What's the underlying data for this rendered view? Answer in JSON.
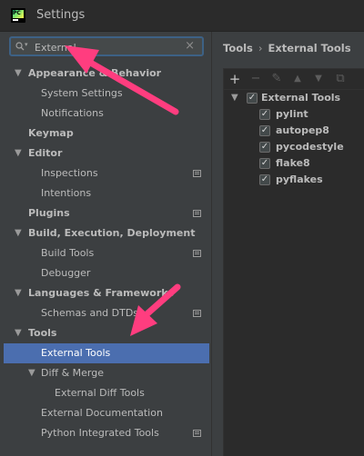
{
  "window": {
    "title": "Settings",
    "app_icon": "pycharm-icon"
  },
  "search": {
    "value": "External",
    "placeholder": ""
  },
  "tree": [
    {
      "label": "Appearance & Behavior",
      "bold": true,
      "expanded": true
    },
    {
      "label": "System Settings"
    },
    {
      "label": "Notifications"
    },
    {
      "label": "Keymap",
      "bold": true
    },
    {
      "label": "Editor",
      "bold": true,
      "expanded": true
    },
    {
      "label": "Inspections",
      "project_icon": true
    },
    {
      "label": "Intentions"
    },
    {
      "label": "Plugins",
      "bold": true,
      "project_icon": true
    },
    {
      "label": "Build, Execution, Deployment",
      "bold": true,
      "expanded": true
    },
    {
      "label": "Build Tools",
      "project_icon": true
    },
    {
      "label": "Debugger"
    },
    {
      "label": "Languages & Frameworks",
      "bold": true,
      "expanded": true
    },
    {
      "label": "Schemas and DTDs",
      "project_icon": true
    },
    {
      "label": "Tools",
      "bold": true,
      "expanded": true
    },
    {
      "label": "External Tools",
      "selected": true
    },
    {
      "label": "Diff & Merge",
      "expanded": true
    },
    {
      "label": "External Diff Tools"
    },
    {
      "label": "External Documentation"
    },
    {
      "label": "Python Integrated Tools",
      "project_icon": true
    }
  ],
  "breadcrumb": {
    "parent": "Tools",
    "separator": "›",
    "current": "External Tools"
  },
  "toolbar": {
    "add": "+",
    "remove": "−",
    "edit": "✎",
    "move_up": "▲",
    "move_down": "▼",
    "copy": "⧉"
  },
  "tools": {
    "group": {
      "label": "External Tools",
      "checked": true,
      "check": "✓"
    },
    "items": [
      {
        "label": "pylint",
        "check": "✓"
      },
      {
        "label": "autopep8",
        "check": "✓"
      },
      {
        "label": "pycodestyle",
        "check": "✓"
      },
      {
        "label": "flake8",
        "check": "✓"
      },
      {
        "label": "pyflakes",
        "check": "✓"
      }
    ]
  },
  "tree_arrows": {
    "expanded": "▼"
  },
  "colors": {
    "accent_selection": "#4b6eaf",
    "callout_arrow": "#ff3d7f",
    "background": "#3c3f41"
  }
}
